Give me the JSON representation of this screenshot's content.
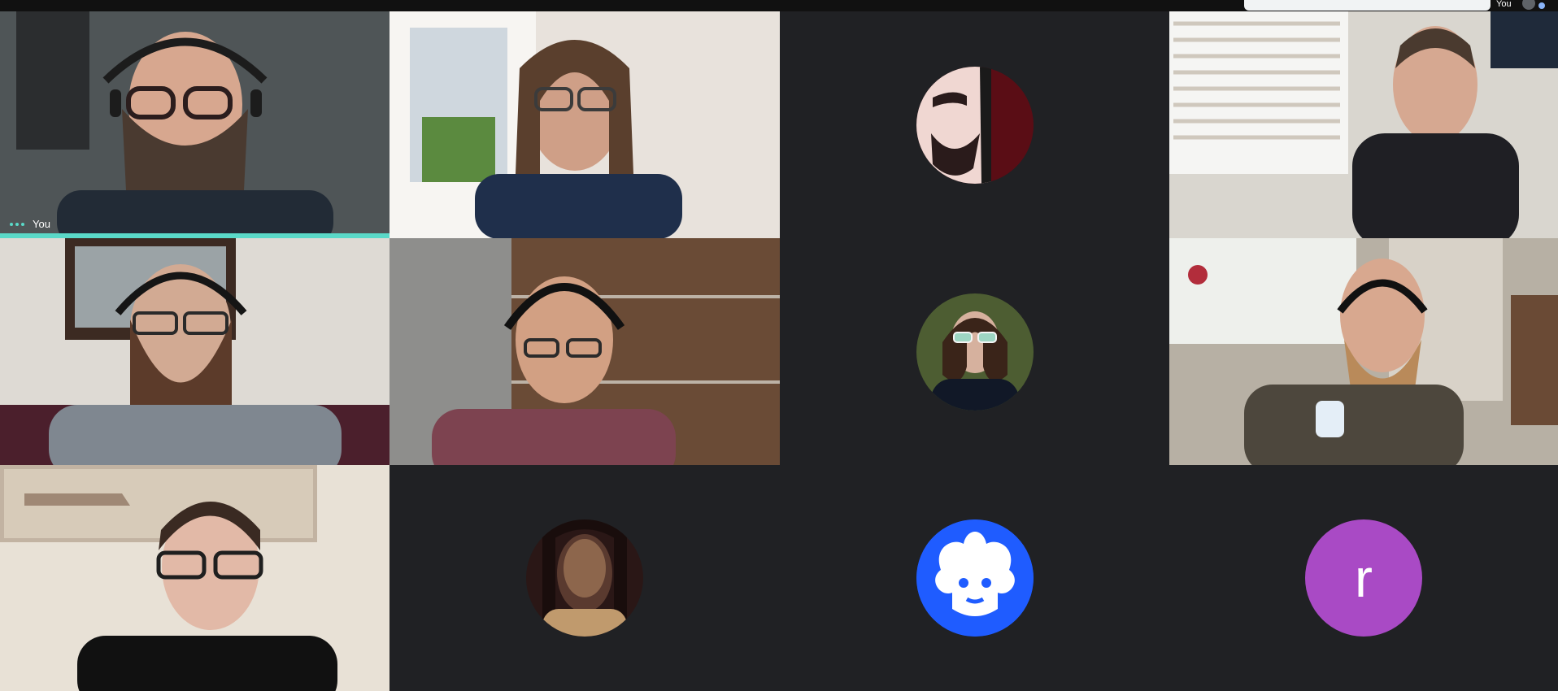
{
  "window": {
    "title": "",
    "self_label": "You",
    "self_badge": "You"
  },
  "tiles": [
    {
      "type": "video",
      "label": "You"
    },
    {
      "type": "video",
      "label": ""
    },
    {
      "type": "avatar",
      "label": ""
    },
    {
      "type": "video",
      "label": ""
    },
    {
      "type": "video",
      "label": ""
    },
    {
      "type": "video",
      "label": ""
    },
    {
      "type": "avatar",
      "label": ""
    },
    {
      "type": "video",
      "label": ""
    },
    {
      "type": "video",
      "label": ""
    },
    {
      "type": "avatar",
      "label": ""
    },
    {
      "type": "avatar",
      "label": ""
    },
    {
      "type": "avatar",
      "label": "r"
    }
  ],
  "colors": {
    "background": "#202124",
    "self_accent": "#5ad9c8",
    "avatar_blue": "#1f5cff",
    "avatar_purple": "#a94ac5"
  },
  "icons": {
    "more": "more-horiz-icon",
    "self_avatar": "avatar-icon"
  }
}
